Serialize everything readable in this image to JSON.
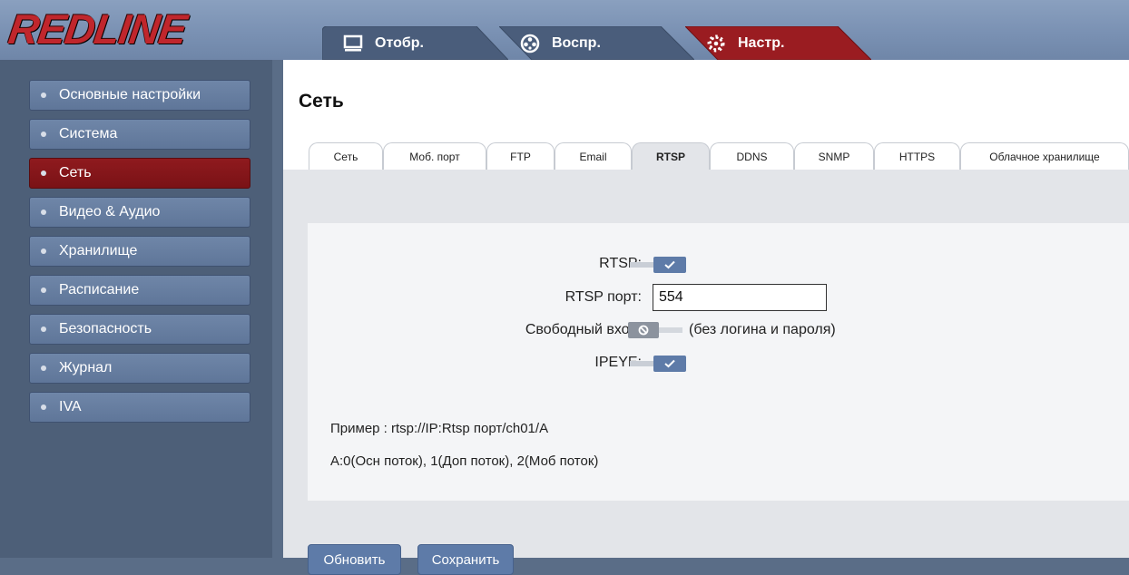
{
  "logo": {
    "text": "REDLINE"
  },
  "nav": {
    "tabs": [
      {
        "label": "Отобр.",
        "icon": "monitor-icon"
      },
      {
        "label": "Воспр.",
        "icon": "film-reel-icon"
      },
      {
        "label": "Настр.",
        "icon": "gear-icon",
        "active": true
      }
    ]
  },
  "sidebar": {
    "items": [
      {
        "label": "Основные настройки"
      },
      {
        "label": "Система"
      },
      {
        "label": "Сеть",
        "active": true
      },
      {
        "label": "Видео & Аудио"
      },
      {
        "label": "Хранилище"
      },
      {
        "label": "Расписание"
      },
      {
        "label": "Безопасность"
      },
      {
        "label": "Журнал"
      },
      {
        "label": "IVA"
      }
    ]
  },
  "page": {
    "title": "Сеть"
  },
  "subtabs": [
    {
      "label": "Сеть"
    },
    {
      "label": "Моб. порт"
    },
    {
      "label": "FTP"
    },
    {
      "label": "Email"
    },
    {
      "label": "RTSP",
      "active": true
    },
    {
      "label": "DDNS"
    },
    {
      "label": "SNMP"
    },
    {
      "label": "HTTPS"
    },
    {
      "label": "Облачное хранилище"
    }
  ],
  "form": {
    "rtsp_label": "RTSP:",
    "rtsp_enabled": true,
    "port_label": "RTSP порт:",
    "port_value": "554",
    "free_login_label": "Свободный вход:",
    "free_login_enabled": false,
    "free_login_hint": "(без логина и пароля)",
    "ipeye_label": "IPEYE:",
    "ipeye_enabled": true
  },
  "notes": {
    "example": "Пример : rtsp://IP:Rtsp порт/ch01/A",
    "streams": "A:0(Осн поток), 1(Доп поток), 2(Моб поток)"
  },
  "buttons": {
    "refresh": "Обновить",
    "save": "Сохранить"
  },
  "colors": {
    "accent_red": "#8f1a1e",
    "accent_blue": "#5e7ba8",
    "sidebar_bg": "#4d5f78",
    "header_bg": "#7a91b3"
  }
}
